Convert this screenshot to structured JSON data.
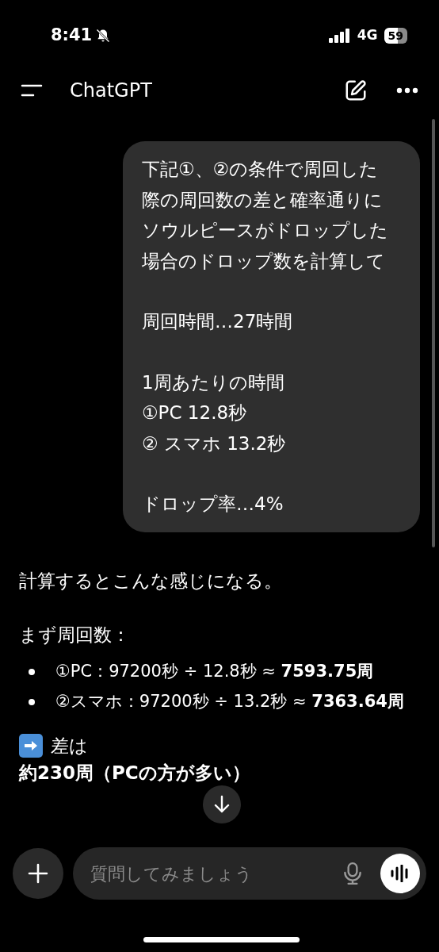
{
  "status_bar": {
    "time": "8:41",
    "network": "4G",
    "battery": "59"
  },
  "header": {
    "title": "ChatGPT"
  },
  "user_message": {
    "paragraphs": [
      [
        "下記①、②の条件で周回した",
        "際の周回数の差と確率通りに",
        "ソウルピースがドロップした",
        "場合のドロップ数を計算して"
      ],
      [
        "周回時間…27時間"
      ],
      [
        "1周あたりの時間",
        "①PC 12.8秒",
        "② スマホ 13.2秒"
      ],
      [
        "ドロップ率…4%"
      ]
    ]
  },
  "assistant_message": {
    "intro": "計算するとこんな感じになる。",
    "heading": "まず周回数：",
    "bullets": [
      "①PC：97200秒 ÷ 12.8秒 ≈ **7593.75周**",
      "②スマホ：97200秒 ÷ 13.2秒 ≈ **7363.64周**"
    ],
    "difference_label": "差は",
    "difference": "約230周（PCの方が多い）"
  },
  "composer": {
    "placeholder": "質問してみましょう"
  }
}
